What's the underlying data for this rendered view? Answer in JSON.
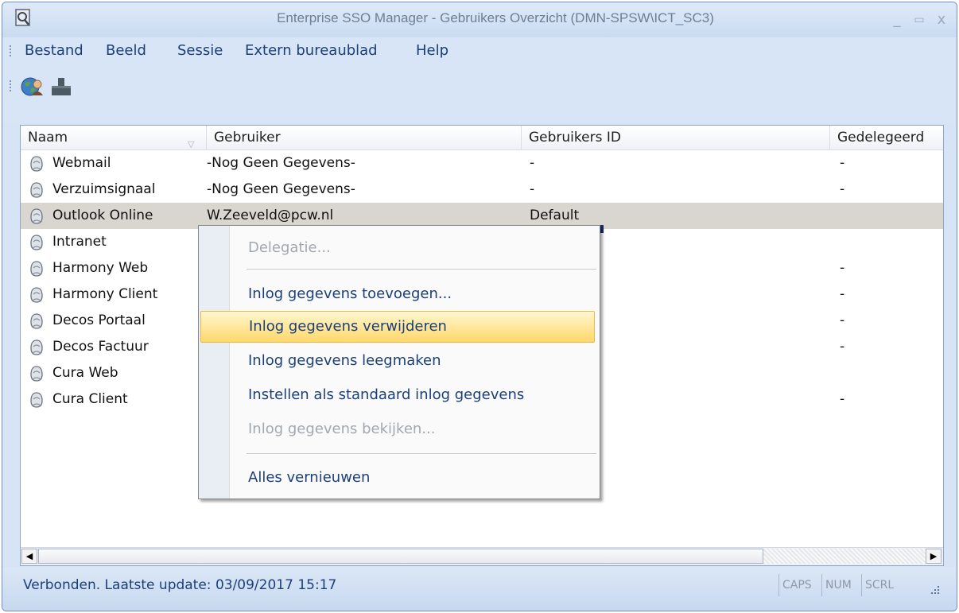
{
  "window": {
    "title": "Enterprise SSO Manager - Gebruikers Overzicht (DMN-SPSW\\ICT_SC3)",
    "controls": [
      "_",
      "▭",
      "x"
    ]
  },
  "menubar": {
    "items": [
      "Bestand",
      "Beeld",
      "Sessie",
      "Extern bureaublad",
      "Help"
    ]
  },
  "toolbar": {
    "buttons": [
      "globe-user-icon",
      "puzzle-icon"
    ]
  },
  "list": {
    "columns": [
      "Naam",
      "Gebruiker",
      "Gebruikers ID",
      "Gedelegeerd"
    ],
    "rows": [
      {
        "naam": "Webmail",
        "gebruiker": "-Nog Geen Gegevens-",
        "id": "-",
        "gedelegeerd": "-"
      },
      {
        "naam": "Verzuimsignaal",
        "gebruiker": "-Nog Geen Gegevens-",
        "id": "-",
        "gedelegeerd": "-"
      },
      {
        "naam": "Outlook Online",
        "gebruiker": "W.Zeeveld@pcw.nl",
        "id": "Default",
        "gedelegeerd": ""
      },
      {
        "naam": "Intranet",
        "gebruiker": "",
        "id": "",
        "gedelegeerd": ""
      },
      {
        "naam": "Harmony Web",
        "gebruiker": "",
        "id": "",
        "gedelegeerd": "-"
      },
      {
        "naam": "Harmony Client",
        "gebruiker": "",
        "id": "",
        "gedelegeerd": "-"
      },
      {
        "naam": "Decos Portaal",
        "gebruiker": "",
        "id": "",
        "gedelegeerd": "-"
      },
      {
        "naam": "Decos Factuur",
        "gebruiker": "",
        "id": "",
        "gedelegeerd": "-"
      },
      {
        "naam": "Cura Web",
        "gebruiker": "",
        "id": "",
        "gedelegeerd": ""
      },
      {
        "naam": "Cura Client",
        "gebruiker": "",
        "id": "",
        "gedelegeerd": "-"
      }
    ],
    "selected_row": "Outlook Online"
  },
  "context_menu": {
    "items": [
      {
        "label": "Delegatie...",
        "enabled": false
      },
      {
        "label": "Inlog gegevens toevoegen...",
        "enabled": true
      },
      {
        "label": "Inlog gegevens verwijderen",
        "enabled": true,
        "highlighted": true
      },
      {
        "label": "Inlog gegevens leegmaken",
        "enabled": true
      },
      {
        "label": "Instellen als standaard inlog gegevens",
        "enabled": true
      },
      {
        "label": "Inlog gegevens bekijken...",
        "enabled": false
      },
      {
        "label": "Alles vernieuwen",
        "enabled": true
      }
    ]
  },
  "statusbar": {
    "text": "Verbonden. Laatste update: 03/09/2017 15:17",
    "indicators": [
      "CAPS",
      "NUM",
      "SCRL"
    ]
  },
  "colors": {
    "menu_text": "#1b3f7a",
    "highlight": "#ffd86b",
    "selected_row": "#d9d5cf",
    "frame": "#d6e4f5"
  }
}
